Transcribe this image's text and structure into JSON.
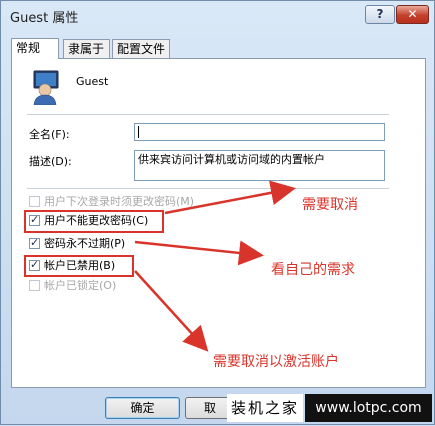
{
  "window": {
    "title": "Guest 属性",
    "help_label": "?",
    "close_label": "✕"
  },
  "tabs": [
    {
      "label": "常规",
      "active": true
    },
    {
      "label": "隶属于",
      "active": false
    },
    {
      "label": "配置文件",
      "active": false
    }
  ],
  "user": {
    "name": "Guest",
    "avatar_icon": "user-account-icon"
  },
  "fields": {
    "full_name_label": "全名(F):",
    "full_name_value": "",
    "description_label": "描述(D):",
    "description_value": "供来宾访问计算机或访问域的内置帐户"
  },
  "options": [
    {
      "label": "用户下次登录时须更改密码(M)",
      "checked": false,
      "enabled": false
    },
    {
      "label": "用户不能更改密码(C)",
      "checked": true,
      "enabled": true
    },
    {
      "label": "密码永不过期(P)",
      "checked": true,
      "enabled": true
    },
    {
      "label": "帐户已禁用(B)",
      "checked": true,
      "enabled": true
    },
    {
      "label": "帐户已锁定(O)",
      "checked": false,
      "enabled": false
    }
  ],
  "annotations": {
    "needs_uncheck": "需要取消",
    "depends": "看自己的需求",
    "uncheck_to_activate": "需要取消以激活账户",
    "color": "#d9342b"
  },
  "buttons": {
    "ok": "确定",
    "cancel": "取"
  },
  "watermark": {
    "site_name": "装机之家",
    "url": "www.lotpc.com"
  }
}
